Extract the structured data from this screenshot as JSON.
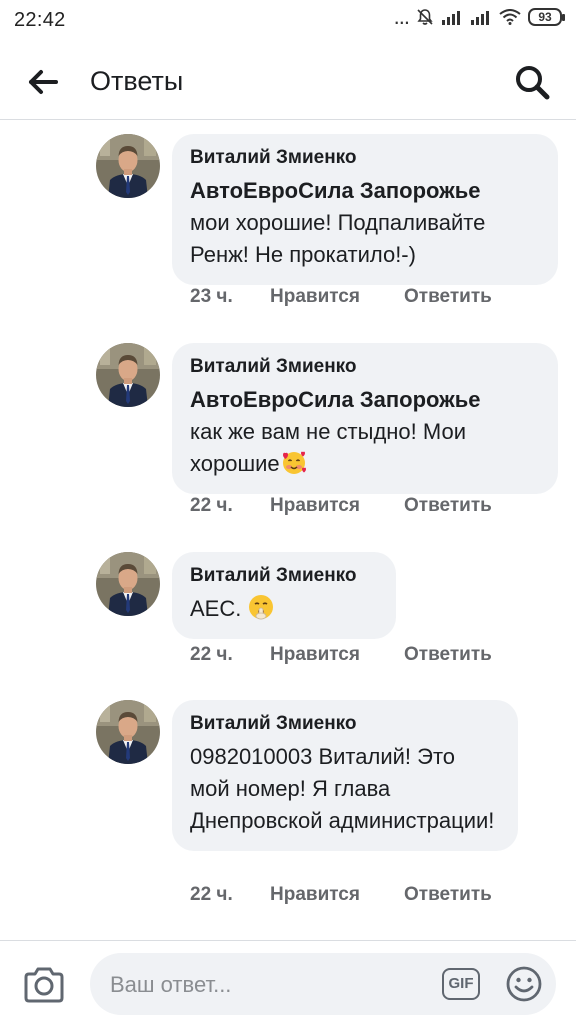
{
  "status_bar": {
    "time": "22:42",
    "overflow": "...",
    "battery": "93"
  },
  "header": {
    "title": "Ответы",
    "back_icon": "arrow-left-icon",
    "search_icon": "search-icon"
  },
  "comments": [
    {
      "author": "Виталий Змиенко",
      "mention": "АвтоЕвроСила Запорожье",
      "text": "мои хорошие! Подпаливайте Ренж! Не прокатило!-)",
      "time": "23 ч.",
      "like_label": "Нравится",
      "reply_label": "Ответить"
    },
    {
      "author": "Виталий Змиенко",
      "mention": "АвтоЕвроСила Запорожье",
      "text": "как же вам не стыдно! Мои хорошие",
      "emoji": "smiling-face-with-hearts-emoji",
      "time": "22 ч.",
      "like_label": "Нравится",
      "reply_label": "Ответить"
    },
    {
      "author": "Виталий Змиенко",
      "text": "АЕС.",
      "emoji": "shushing-face-emoji",
      "time": "22 ч.",
      "like_label": "Нравится",
      "reply_label": "Ответить"
    },
    {
      "author": "Виталий Змиенко",
      "text": "0982010003 Виталий! Это мой номер! Я глава Днепровской администрации!",
      "time": "22 ч.",
      "like_label": "Нравится",
      "reply_label": "Ответить"
    }
  ],
  "composer": {
    "placeholder": "Ваш ответ...",
    "gif_label": "GIF",
    "camera_icon": "camera-icon",
    "emoji_icon": "smiley-icon"
  }
}
